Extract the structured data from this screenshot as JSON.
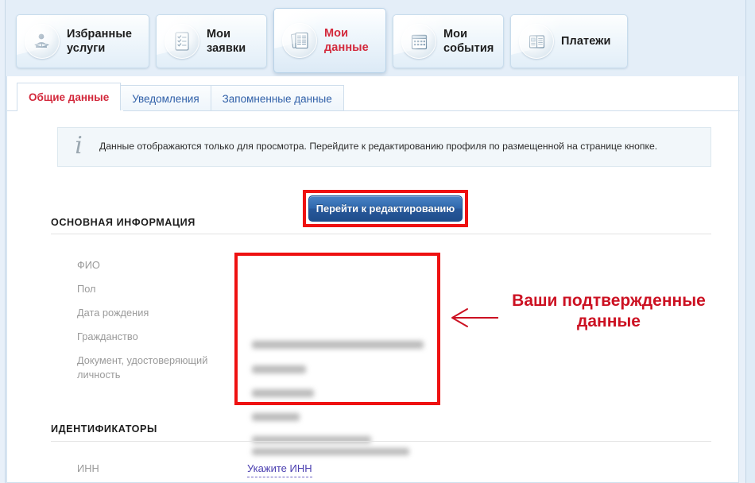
{
  "window": {
    "title": "Мои данные"
  },
  "colors": {
    "accent_red": "#d3293c",
    "callout_red": "#ee1111",
    "annotation_red": "#cc1122",
    "link_blue": "#2f5fa8",
    "button_blue": "#27589a",
    "inn_link_violet": "#4b3fb0",
    "header_bg": "#e4eef8",
    "panel_bg": "#ffffff",
    "banner_bg": "#f2f7fa",
    "label_gray": "#9a9a9a"
  },
  "tabbar": {
    "tabs": [
      {
        "label_line1": "Избранные",
        "label_line2": "услуги",
        "icon": "person-reading-icon",
        "active": false
      },
      {
        "label_line1": "Мои",
        "label_line2": "заявки",
        "icon": "checklist-icon",
        "active": false
      },
      {
        "label_line1": "Мои",
        "label_line2": "данные",
        "icon": "documents-icon",
        "active": true
      },
      {
        "label_line1": "Мои",
        "label_line2": "события",
        "icon": "calendar-icon",
        "active": false
      },
      {
        "label_line1": "Платежи",
        "label_line2": "",
        "icon": "wallet-card-icon",
        "active": false
      }
    ]
  },
  "subtabs": {
    "items": [
      {
        "label": "Общие данные",
        "active": true
      },
      {
        "label": "Уведомления",
        "active": false
      },
      {
        "label": "Запомненные данные",
        "active": false
      }
    ]
  },
  "banner": {
    "icon": "info-icon",
    "text": "Данные отображаются только для просмотра. Перейдите к редактированию профиля по размещенной на странице кнопке."
  },
  "actions": {
    "edit_button_label": "Перейти к редактированию"
  },
  "sections": [
    {
      "title": "ОСНОВНАЯ ИНФОРМАЦИЯ",
      "fields": [
        {
          "label": "ФИО",
          "value": "",
          "redacted": true
        },
        {
          "label": "Пол",
          "value": "",
          "redacted": true
        },
        {
          "label": "Дата рождения",
          "value": "",
          "redacted": true
        },
        {
          "label": "Гражданство",
          "value": "",
          "redacted": true
        },
        {
          "label": "Документ, удостоверяющий личность",
          "value": "",
          "redacted": true
        }
      ]
    },
    {
      "title": "ИДЕНТИФИКАТОРЫ",
      "fields": [
        {
          "label": "ИНН",
          "value": "Укажите ИНН",
          "redacted": false,
          "is_link": true
        }
      ]
    }
  ],
  "annotation": {
    "text": "Ваши подтвержденные данные",
    "arrow": "left-arrow-icon"
  }
}
